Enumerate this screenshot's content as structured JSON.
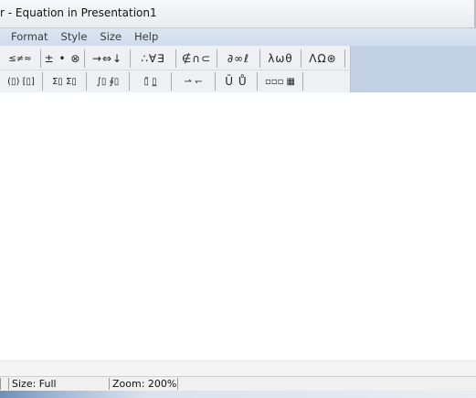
{
  "window": {
    "title": "r - Equation in Presentation1"
  },
  "menu": {
    "items": [
      "Format",
      "Style",
      "Size",
      "Help"
    ]
  },
  "toolbar": {
    "row1": [
      {
        "name": "relational-templates-group",
        "glyphs": "≤≠≈"
      },
      {
        "name": "operator-templates-group",
        "glyphs": "± • ⊗"
      },
      {
        "name": "arrow-templates-group",
        "glyphs": "→⇔↓"
      },
      {
        "name": "logical-templates-group",
        "glyphs": "∴∀∃"
      },
      {
        "name": "set-theory-templates-group",
        "glyphs": "∉∩⊂"
      },
      {
        "name": "misc-symbols-group",
        "glyphs": "∂∞ℓ"
      },
      {
        "name": "greek-lower-group",
        "glyphs": "λωθ"
      },
      {
        "name": "greek-upper-group",
        "glyphs": "ΛΩ⊛"
      }
    ],
    "row2": [
      {
        "name": "fence-templates-group",
        "glyphs": "(▯) [▯]"
      },
      {
        "name": "fraction-radical-group",
        "glyphs": "▯/▯ √▯"
      },
      {
        "name": "sub-superscript-group",
        "glyphs": "x▯ ▯x"
      },
      {
        "name": "summation-templates-group",
        "glyphs": "Σ▯ Σ▯"
      },
      {
        "name": "integral-templates-group",
        "glyphs": "∫▯ ∮▯"
      },
      {
        "name": "underbar-overbar-group",
        "glyphs": "▯̄ ▯̲"
      },
      {
        "name": "labeled-arrow-group",
        "glyphs": "⇀ ↽"
      },
      {
        "name": "products-set-group",
        "glyphs": "Ū Ů"
      },
      {
        "name": "matrix-templates-group",
        "glyphs": "▫▫▫ ▦"
      }
    ]
  },
  "status": {
    "style": "",
    "size": "Size: Full",
    "zoom": "Zoom: 200%"
  }
}
